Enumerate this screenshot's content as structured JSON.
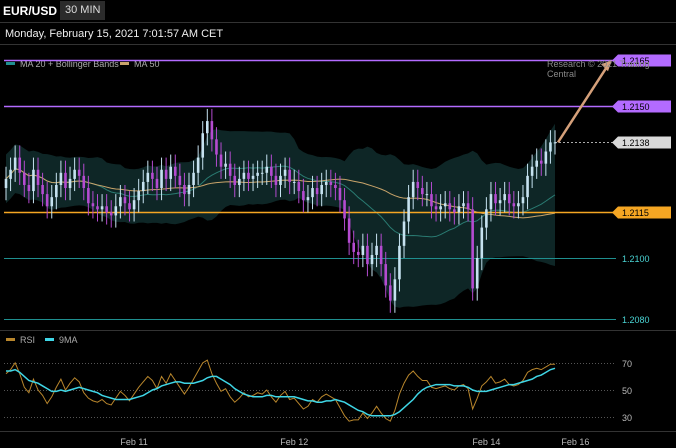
{
  "header": {
    "symbol": "EUR/USD",
    "timeframe": "30 MIN",
    "datetime": "Monday, February 15, 2021 7:01:57 AM CET",
    "credit": "Research © 2021 Trading Central"
  },
  "colors": {
    "background": "#000000",
    "bullish": "#c6e2f0",
    "bearish": "#b44bd0",
    "resistance": "#b36bff",
    "support": "#f5a623",
    "level_teal": "#1f8f8f",
    "bollinger_fill": "#0e2626",
    "ma20": "#2a7b72",
    "ma50": "#c9a46a",
    "arrow": "#d5a07a",
    "rsi": "#b8862c",
    "rsi_ma": "#3fd6e6"
  },
  "chart_data": [
    {
      "type": "line",
      "title": "EUR/USD 30 MIN",
      "legend": [
        {
          "label": "MA 20 + Bollinger Bands",
          "color": "#1f8f8f"
        },
        {
          "label": "MA 50",
          "color": "#c9a46a"
        }
      ],
      "x_ticks": [
        "Feb 11",
        "Feb 12",
        "Feb 14",
        "Feb 16"
      ],
      "ylim": [
        1.2077,
        1.217
      ],
      "levels": [
        {
          "value": 1.2165,
          "label": "1.2165",
          "kind": "resistance"
        },
        {
          "value": 1.215,
          "label": "1.2150",
          "kind": "resistance"
        },
        {
          "value": 1.2138,
          "label": "1.2138",
          "kind": "last"
        },
        {
          "value": 1.2115,
          "label": "1.2115",
          "kind": "pivot"
        },
        {
          "value": 1.21,
          "label": "1.2100",
          "kind": "support"
        },
        {
          "value": 1.208,
          "label": "1.2080",
          "kind": "support"
        }
      ],
      "close": [
        1.2126,
        1.2129,
        1.2133,
        1.2128,
        1.2124,
        1.2122,
        1.2129,
        1.2124,
        1.2121,
        1.2117,
        1.212,
        1.2124,
        1.2128,
        1.2123,
        1.2126,
        1.2129,
        1.2127,
        1.2123,
        1.2118,
        1.2117,
        1.2116,
        1.2117,
        1.2115,
        1.2114,
        1.2117,
        1.212,
        1.2118,
        1.2116,
        1.2119,
        1.2122,
        1.2125,
        1.2128,
        1.2126,
        1.2123,
        1.2129,
        1.2126,
        1.213,
        1.2127,
        1.2124,
        1.2121,
        1.2124,
        1.2128,
        1.2133,
        1.2141,
        1.2145,
        1.2139,
        1.2134,
        1.213,
        1.2131,
        1.2127,
        1.2124,
        1.2126,
        1.2128,
        1.2126,
        1.2127,
        1.2128,
        1.2128,
        1.213,
        1.2127,
        1.2124,
        1.2127,
        1.2129,
        1.2125,
        1.2125,
        1.2122,
        1.2119,
        1.212,
        1.2123,
        1.2121,
        1.2124,
        1.2125,
        1.2124,
        1.2123,
        1.2119,
        1.2113,
        1.2105,
        1.2102,
        1.2101,
        1.2104,
        1.2098,
        1.2101,
        1.2104,
        1.2098,
        1.2091,
        1.2086,
        1.2093,
        1.2104,
        1.2112,
        1.212,
        1.2125,
        1.2123,
        1.2121,
        1.2121,
        1.2117,
        1.2116,
        1.2117,
        1.2118,
        1.2116,
        1.2115,
        1.2117,
        1.2118,
        1.2116,
        1.209,
        1.21,
        1.211,
        1.2116,
        1.2121,
        1.2118,
        1.2119,
        1.2121,
        1.2118,
        1.2117,
        1.2118,
        1.212,
        1.2127,
        1.213,
        1.2132,
        1.2131,
        1.2135,
        1.2138,
        1.2138
      ]
    },
    {
      "type": "line",
      "title": "RSI",
      "legend": [
        {
          "label": "RSI",
          "color": "#b8862c"
        },
        {
          "label": "9MA",
          "color": "#3fd6e6"
        }
      ],
      "y_ticks": [
        70,
        50,
        30
      ],
      "ylim": [
        22,
        78
      ],
      "rsi": [
        62,
        65,
        70,
        62,
        52,
        48,
        58,
        50,
        46,
        40,
        45,
        52,
        58,
        50,
        55,
        59,
        56,
        48,
        44,
        42,
        41,
        43,
        40,
        39,
        44,
        49,
        46,
        42,
        47,
        52,
        56,
        60,
        57,
        51,
        60,
        55,
        62,
        57,
        52,
        47,
        52,
        58,
        64,
        70,
        72,
        62,
        55,
        49,
        51,
        45,
        41,
        44,
        48,
        45,
        46,
        48,
        47,
        50,
        45,
        41,
        46,
        49,
        43,
        44,
        40,
        36,
        38,
        43,
        41,
        45,
        47,
        45,
        43,
        37,
        31,
        27,
        28,
        28,
        33,
        29,
        33,
        38,
        33,
        29,
        27,
        35,
        47,
        55,
        61,
        64,
        60,
        57,
        57,
        52,
        51,
        52,
        53,
        51,
        50,
        53,
        54,
        51,
        36,
        44,
        53,
        56,
        60,
        55,
        56,
        58,
        54,
        53,
        54,
        57,
        63,
        65,
        66,
        65,
        67,
        69,
        69
      ],
      "rsi_ma": [
        64,
        64,
        65,
        63,
        60,
        57,
        56,
        55,
        53,
        51,
        49,
        49,
        50,
        49,
        50,
        51,
        52,
        51,
        50,
        49,
        48,
        46,
        45,
        44,
        43,
        43,
        43,
        43,
        44,
        45,
        46,
        48,
        50,
        51,
        53,
        54,
        55,
        56,
        56,
        55,
        55,
        55,
        56,
        57,
        59,
        60,
        60,
        58,
        56,
        54,
        51,
        49,
        47,
        46,
        45,
        45,
        45,
        46,
        46,
        45,
        45,
        45,
        45,
        45,
        44,
        43,
        42,
        42,
        41,
        41,
        42,
        42,
        43,
        42,
        41,
        39,
        37,
        35,
        34,
        32,
        31,
        31,
        31,
        31,
        31,
        32,
        34,
        37,
        40,
        43,
        47,
        50,
        52,
        53,
        54,
        54,
        54,
        54,
        53,
        53,
        53,
        52,
        50,
        49,
        49,
        49,
        50,
        51,
        52,
        53,
        54,
        54,
        55,
        56,
        57,
        58,
        60,
        61,
        63,
        65,
        66
      ]
    }
  ]
}
